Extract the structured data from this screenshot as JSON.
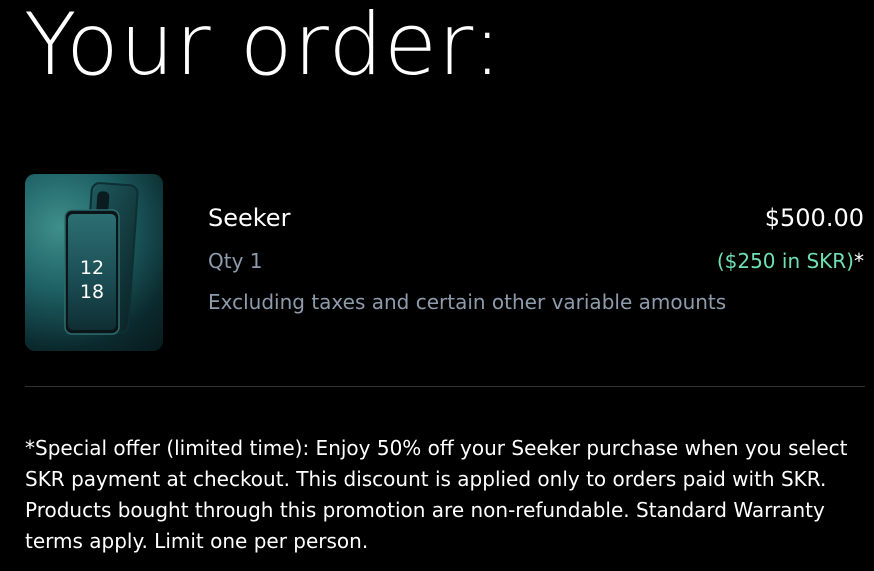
{
  "page": {
    "title": "Your order:"
  },
  "item": {
    "name": "Seeker",
    "qty": "Qty 1",
    "note": "Excluding taxes and certain other variable amounts",
    "price": "$500.00",
    "alt_price": "($250 in SKR)",
    "alt_price_marker": "*",
    "thumbnail": {
      "icon": "phone-product-image",
      "clock_hour": "12",
      "clock_minute": "18"
    }
  },
  "disclaimer": {
    "text": "*Special offer (limited time): Enjoy 50% off your Seeker purchase when you select SKR payment at checkout. This discount is applied only to orders paid with SKR. Products bought through this promotion are non-refundable. Standard Warranty terms apply. Limit one per person."
  },
  "colors": {
    "background": "#000000",
    "text": "#ffffff",
    "muted": "#8e9bac",
    "accent_green": "#6fe0b3",
    "divider": "#333333"
  }
}
